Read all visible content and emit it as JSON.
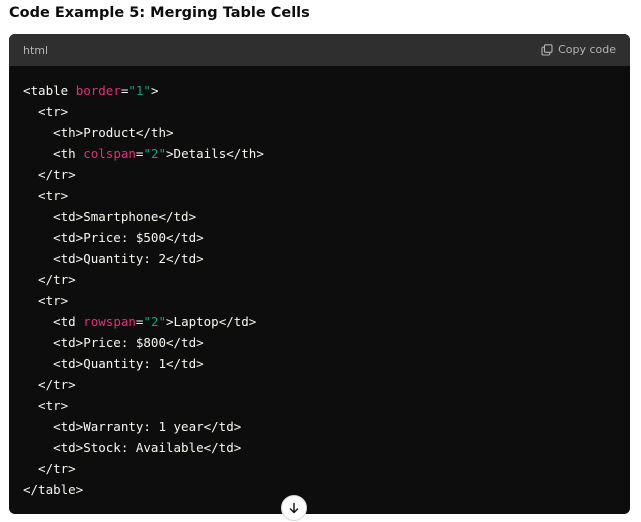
{
  "heading": "Code Example 5: Merging Table Cells",
  "code_block": {
    "language": "html",
    "copy_label": "Copy code",
    "copy_icon": "copy-icon",
    "lines": [
      [
        {
          "t": "<table "
        },
        {
          "t": "border",
          "c": "attr"
        },
        {
          "t": "="
        },
        {
          "t": "\"1\"",
          "c": "str"
        },
        {
          "t": ">"
        }
      ],
      [
        {
          "t": "  <tr>"
        }
      ],
      [
        {
          "t": "    <th>Product</th>"
        }
      ],
      [
        {
          "t": "    <th "
        },
        {
          "t": "colspan",
          "c": "attr"
        },
        {
          "t": "="
        },
        {
          "t": "\"2\"",
          "c": "str"
        },
        {
          "t": ">Details</th>"
        }
      ],
      [
        {
          "t": "  </tr>"
        }
      ],
      [
        {
          "t": "  <tr>"
        }
      ],
      [
        {
          "t": "    <td>Smartphone</td>"
        }
      ],
      [
        {
          "t": "    <td>Price: $500</td>"
        }
      ],
      [
        {
          "t": "    <td>Quantity: 2</td>"
        }
      ],
      [
        {
          "t": "  </tr>"
        }
      ],
      [
        {
          "t": "  <tr>"
        }
      ],
      [
        {
          "t": "    <td "
        },
        {
          "t": "rowspan",
          "c": "attr"
        },
        {
          "t": "="
        },
        {
          "t": "\"2\"",
          "c": "str"
        },
        {
          "t": ">Laptop</td>"
        }
      ],
      [
        {
          "t": "    <td>Price: $800</td>"
        }
      ],
      [
        {
          "t": "    <td>Quantity: 1</td>"
        }
      ],
      [
        {
          "t": "  </tr>"
        }
      ],
      [
        {
          "t": "  <tr>"
        }
      ],
      [
        {
          "t": "    <td>Warranty: 1 year</td>"
        }
      ],
      [
        {
          "t": "    <td>Stock: Available</td>"
        }
      ],
      [
        {
          "t": "  </tr>"
        }
      ],
      [
        {
          "t": "</table>"
        }
      ]
    ]
  },
  "scroll_button_icon": "arrow-down-icon",
  "colors": {
    "code_background": "#0d0d0d",
    "header_background": "#2f2f2f",
    "attribute": "#df3079",
    "string": "#00a67d",
    "text": "#f8f8f2"
  }
}
